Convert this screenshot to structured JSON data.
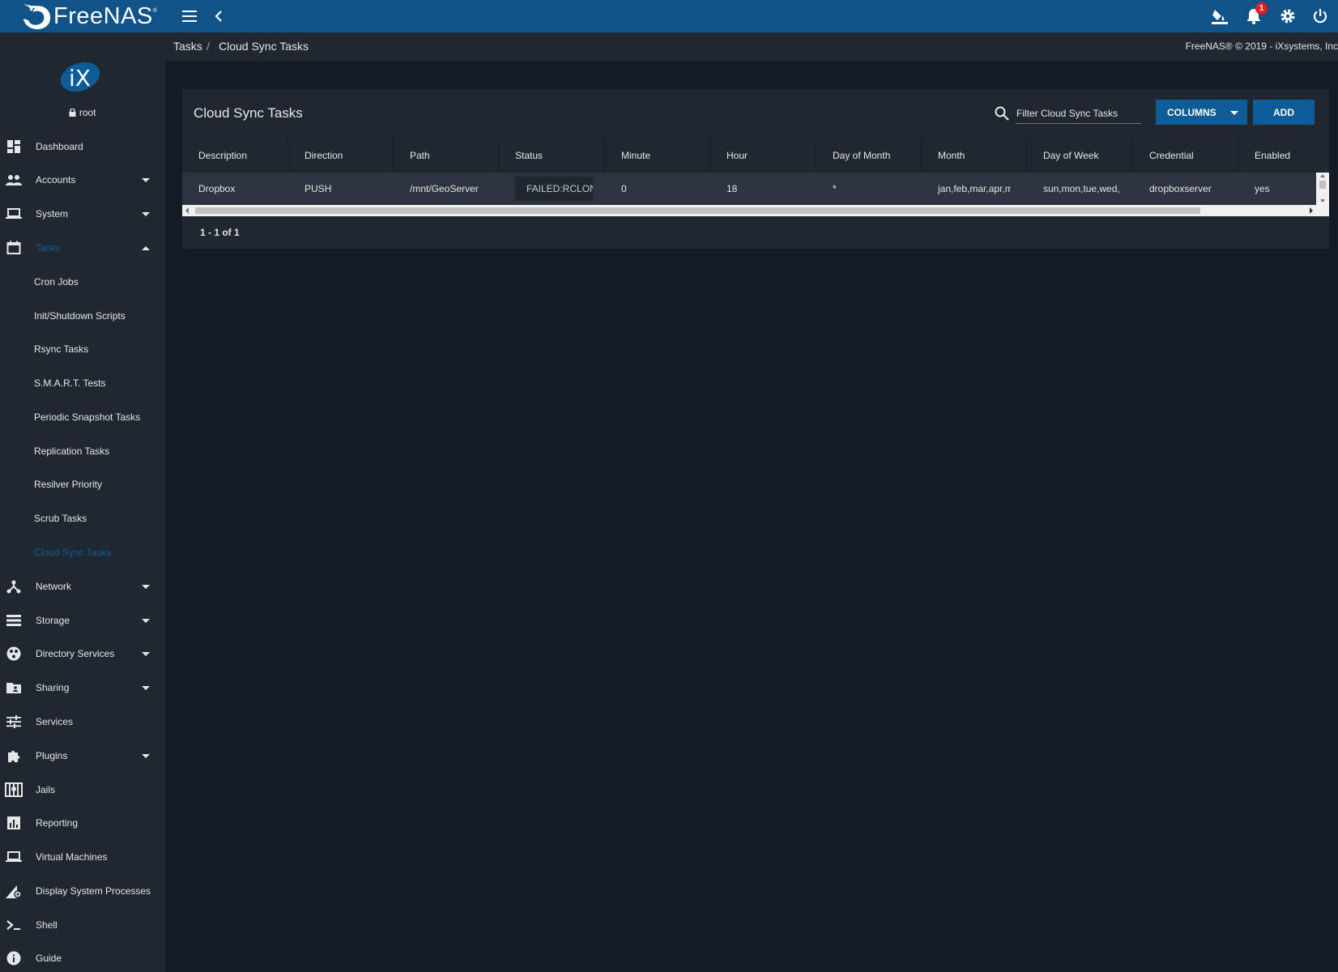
{
  "app": {
    "logo_text": "FreeNAS",
    "logo_mark": "®"
  },
  "topbar": {
    "notification_count": "1",
    "icons": [
      "menu-icon",
      "back-arrow-icon",
      "theme-bucket-icon",
      "bell-icon",
      "gear-icon",
      "power-icon"
    ]
  },
  "sidebar": {
    "user": "root",
    "items": [
      {
        "label": "Dashboard",
        "icon": "dashboard-icon"
      },
      {
        "label": "Accounts",
        "icon": "people-icon"
      },
      {
        "label": "System",
        "icon": "laptop-icon"
      },
      {
        "label": "Tasks",
        "icon": "calendar-icon"
      },
      {
        "label": "Cron Jobs"
      },
      {
        "label": "Init/Shutdown Scripts"
      },
      {
        "label": "Rsync Tasks"
      },
      {
        "label": "S.M.A.R.T. Tests"
      },
      {
        "label": "Periodic Snapshot Tasks"
      },
      {
        "label": "Replication Tasks"
      },
      {
        "label": "Resilver Priority"
      },
      {
        "label": "Scrub Tasks"
      },
      {
        "label": "Cloud Sync Tasks"
      },
      {
        "label": "Network",
        "icon": "network-icon"
      },
      {
        "label": "Storage",
        "icon": "storage-icon"
      },
      {
        "label": "Directory Services",
        "icon": "directory-icon"
      },
      {
        "label": "Sharing",
        "icon": "shared-folder-icon"
      },
      {
        "label": "Services",
        "icon": "sliders-icon"
      },
      {
        "label": "Plugins",
        "icon": "puzzle-icon"
      },
      {
        "label": "Jails",
        "icon": "jail-icon"
      },
      {
        "label": "Reporting",
        "icon": "bar-chart-icon"
      },
      {
        "label": "Virtual Machines",
        "icon": "laptop-icon"
      },
      {
        "label": "Display System Processes",
        "icon": "processes-icon"
      },
      {
        "label": "Shell",
        "icon": "terminal-icon"
      },
      {
        "label": "Guide",
        "icon": "info-icon"
      }
    ]
  },
  "breadcrumb": {
    "parent": "Tasks",
    "separator": "/",
    "current": "Cloud Sync Tasks"
  },
  "copyright": "FreeNAS® © 2019 - iXsystems, Inc",
  "card": {
    "title": "Cloud Sync Tasks",
    "filter_placeholder": "Filter Cloud Sync Tasks",
    "columns_button": "COLUMNS",
    "add_button": "ADD",
    "columns": [
      "Description",
      "Direction",
      "Path",
      "Status",
      "Minute",
      "Hour",
      "Day of Month",
      "Month",
      "Day of Week",
      "Credential",
      "Enabled"
    ],
    "rows": [
      {
        "description": "Dropbox",
        "direction": "PUSH",
        "path": "/mnt/GeoServer",
        "status": "FAILED:RCLONE",
        "minute": "0",
        "hour": "18",
        "day_of_month": "*",
        "month": "jan,feb,mar,apr,may",
        "day_of_week": "sun,mon,tue,wed,",
        "credential": "dropboxserver",
        "enabled": "yes"
      }
    ],
    "pager": "1 - 1 of 1"
  },
  "colors": {
    "topbar": "#0f5389",
    "sidebar": "#1f2731",
    "background": "#151b24",
    "accent": "#0d5c97",
    "error_badge": "#e51c23"
  }
}
